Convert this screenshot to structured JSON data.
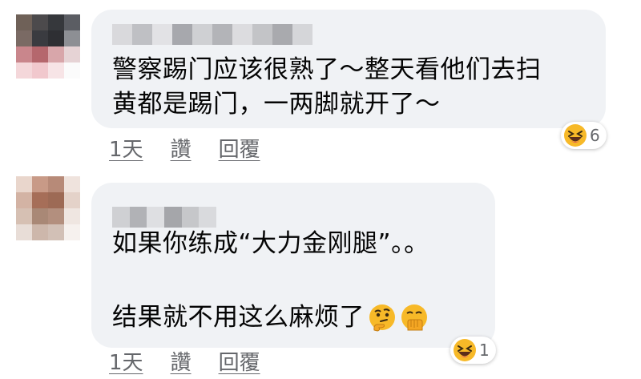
{
  "comments": [
    {
      "text_lines": [
        "警察踢门应该很熟了～整天看他们去扫",
        "黄都是踢门，一两脚就开了～"
      ],
      "actions": {
        "time": "1天",
        "like": "讚",
        "reply": "回覆"
      },
      "reaction": {
        "icon": "laughing-emoji-icon",
        "count": "6"
      },
      "avatar_colors": [
        "#6f6158",
        "#4c4a4c",
        "#36383c",
        "#5b5d63",
        "#7a6a64",
        "#3a3b40",
        "#2e2f33",
        "#8d8f94",
        "#c9868c",
        "#b5676d",
        "#d8a6aa",
        "#e6d3d5",
        "#f4d7da",
        "#f1c8cd",
        "#f7e4e6",
        "#fbfbfb"
      ]
    },
    {
      "text_lines": [
        "如果你练成“大力金刚腿”。。",
        "",
        "结果就不用这么麻烦了"
      ],
      "trailing_emojis": [
        "thinking-emoji-icon",
        "hand-over-mouth-emoji-icon"
      ],
      "actions": {
        "time": "1天",
        "like": "讚",
        "reply": "回覆"
      },
      "reaction": {
        "icon": "laughing-emoji-icon",
        "count": "1"
      },
      "avatar_colors": [
        "#e9d6cc",
        "#c89a87",
        "#b78a78",
        "#efe3dd",
        "#d3b3a4",
        "#a66e58",
        "#9d6a55",
        "#e4d2c9",
        "#d6c0b3",
        "#a98876",
        "#b38f7e",
        "#efe6e1",
        "#e8ddd7",
        "#cdb7ab",
        "#d2c0b6",
        "#f6f1ee"
      ]
    }
  ]
}
